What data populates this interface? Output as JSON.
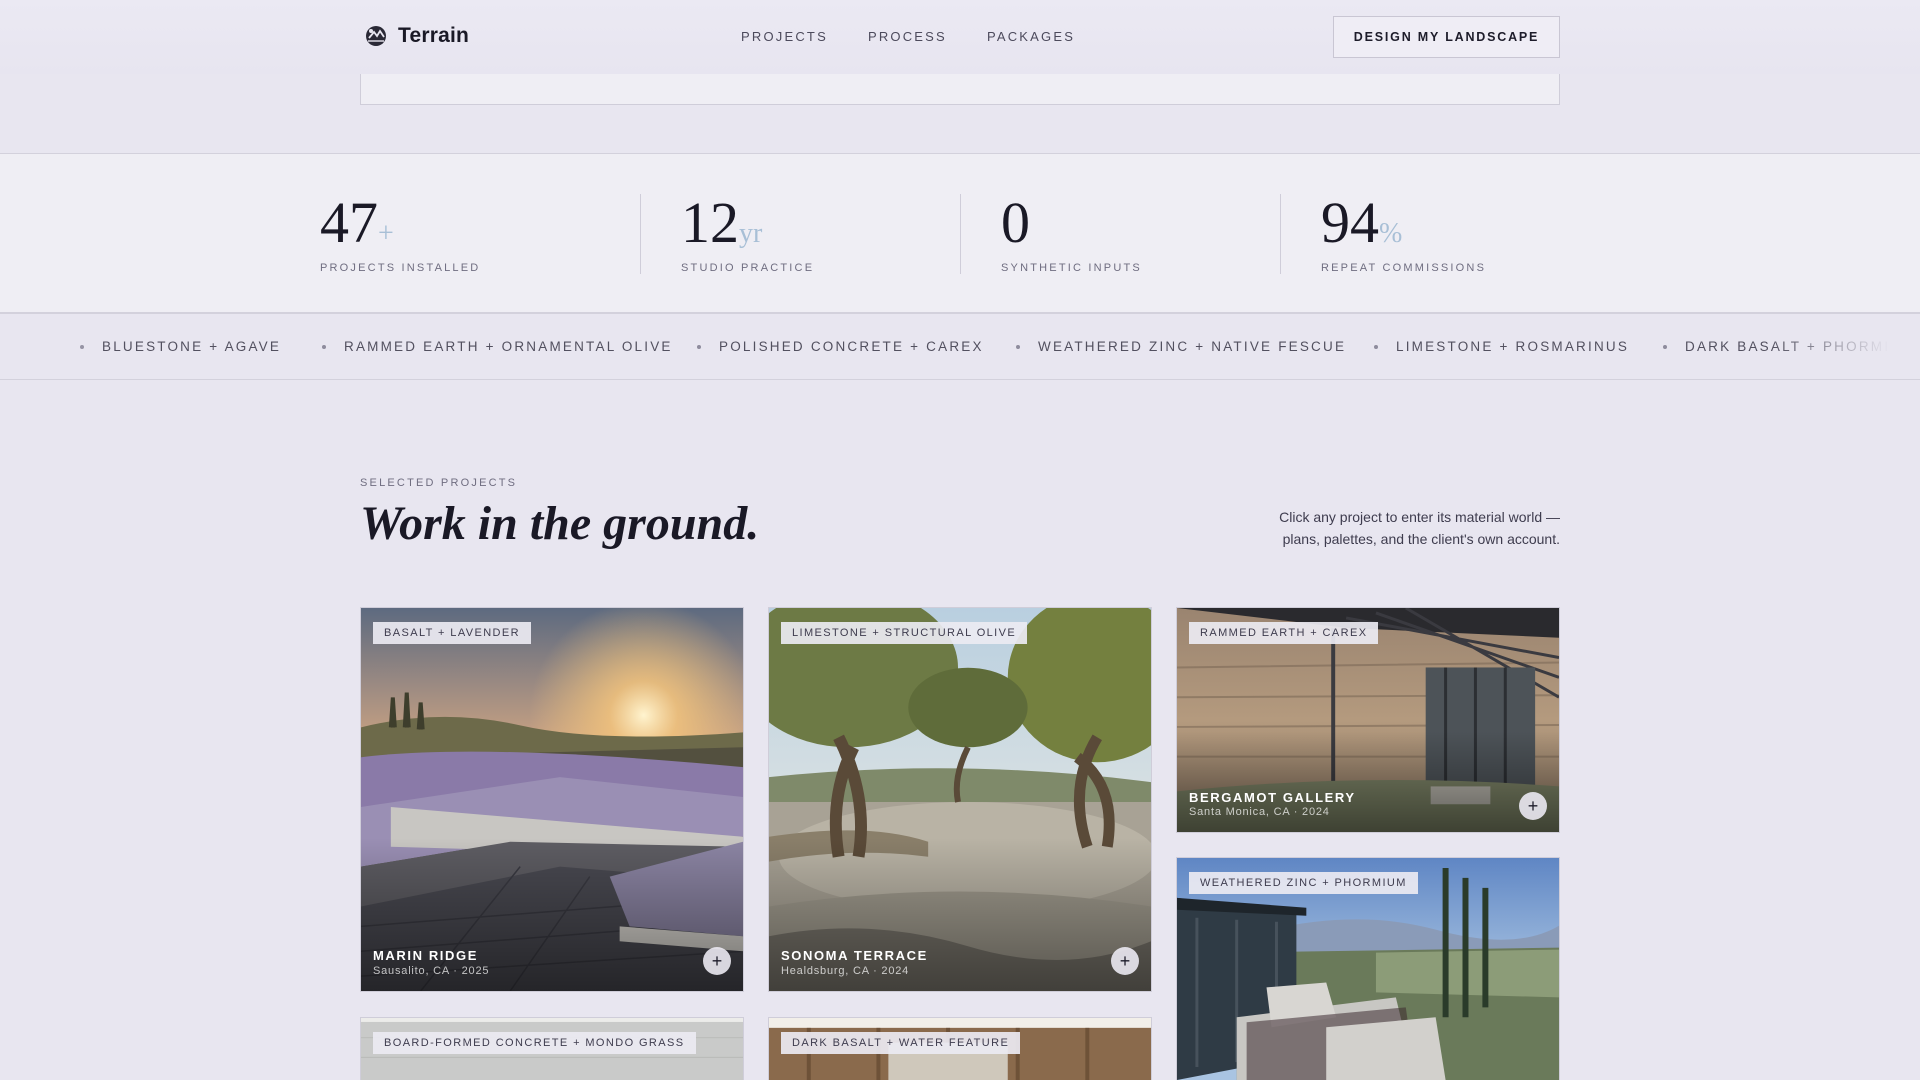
{
  "nav": {
    "brand": "Terrain",
    "links": [
      "PROJECTS",
      "PROCESS",
      "PACKAGES"
    ],
    "cta": "DESIGN MY LANDSCAPE",
    "icons": {
      "logo": "logo-mark-icon"
    }
  },
  "stats": [
    {
      "value": "47",
      "suffix": "+",
      "label": "PROJECTS INSTALLED"
    },
    {
      "value": "12",
      "suffix": "yr",
      "label": "STUDIO PRACTICE"
    },
    {
      "value": "0",
      "suffix": "",
      "label": "SYNTHETIC INPUTS"
    },
    {
      "value": "94",
      "suffix": "%",
      "label": "REPEAT COMMISSIONS"
    }
  ],
  "marquee": [
    "BLUESTONE + AGAVE",
    "RAMMED EARTH + ORNAMENTAL OLIVE",
    "POLISHED CONCRETE + CAREX",
    "WEATHERED ZINC + NATIVE FESCUE",
    "LIMESTONE + ROSMARINUS",
    "DARK BASALT + PHORMIUM"
  ],
  "projects_header": {
    "kicker": "SELECTED PROJECTS",
    "headline": "Work in the ground.",
    "blurb": "Click any project to enter its material world — plans, palettes, and the client's own account."
  },
  "projects": [
    {
      "tag": "BASALT + LAVENDER",
      "title": "MARIN RIDGE",
      "sub": "Sausalito, CA · 2025"
    },
    {
      "tag": "LIMESTONE + STRUCTURAL OLIVE",
      "title": "SONOMA TERRACE",
      "sub": "Healdsburg, CA · 2024"
    },
    {
      "tag": "RAMMED EARTH + CAREX",
      "title": "BERGAMOT GALLERY",
      "sub": "Santa Monica, CA · 2024"
    },
    {
      "tag": "WEATHERED ZINC + PHORMIUM",
      "title": "",
      "sub": ""
    },
    {
      "tag": "BOARD-FORMED CONCRETE + MONDO GRASS",
      "title": "",
      "sub": ""
    },
    {
      "tag": "DARK BASALT + WATER FEATURE",
      "title": "",
      "sub": ""
    }
  ],
  "colors": {
    "background": "#e8e6f0",
    "panel": "#efeef4",
    "ink": "#1a1926",
    "accent_suffix": "#a8bfd6"
  }
}
